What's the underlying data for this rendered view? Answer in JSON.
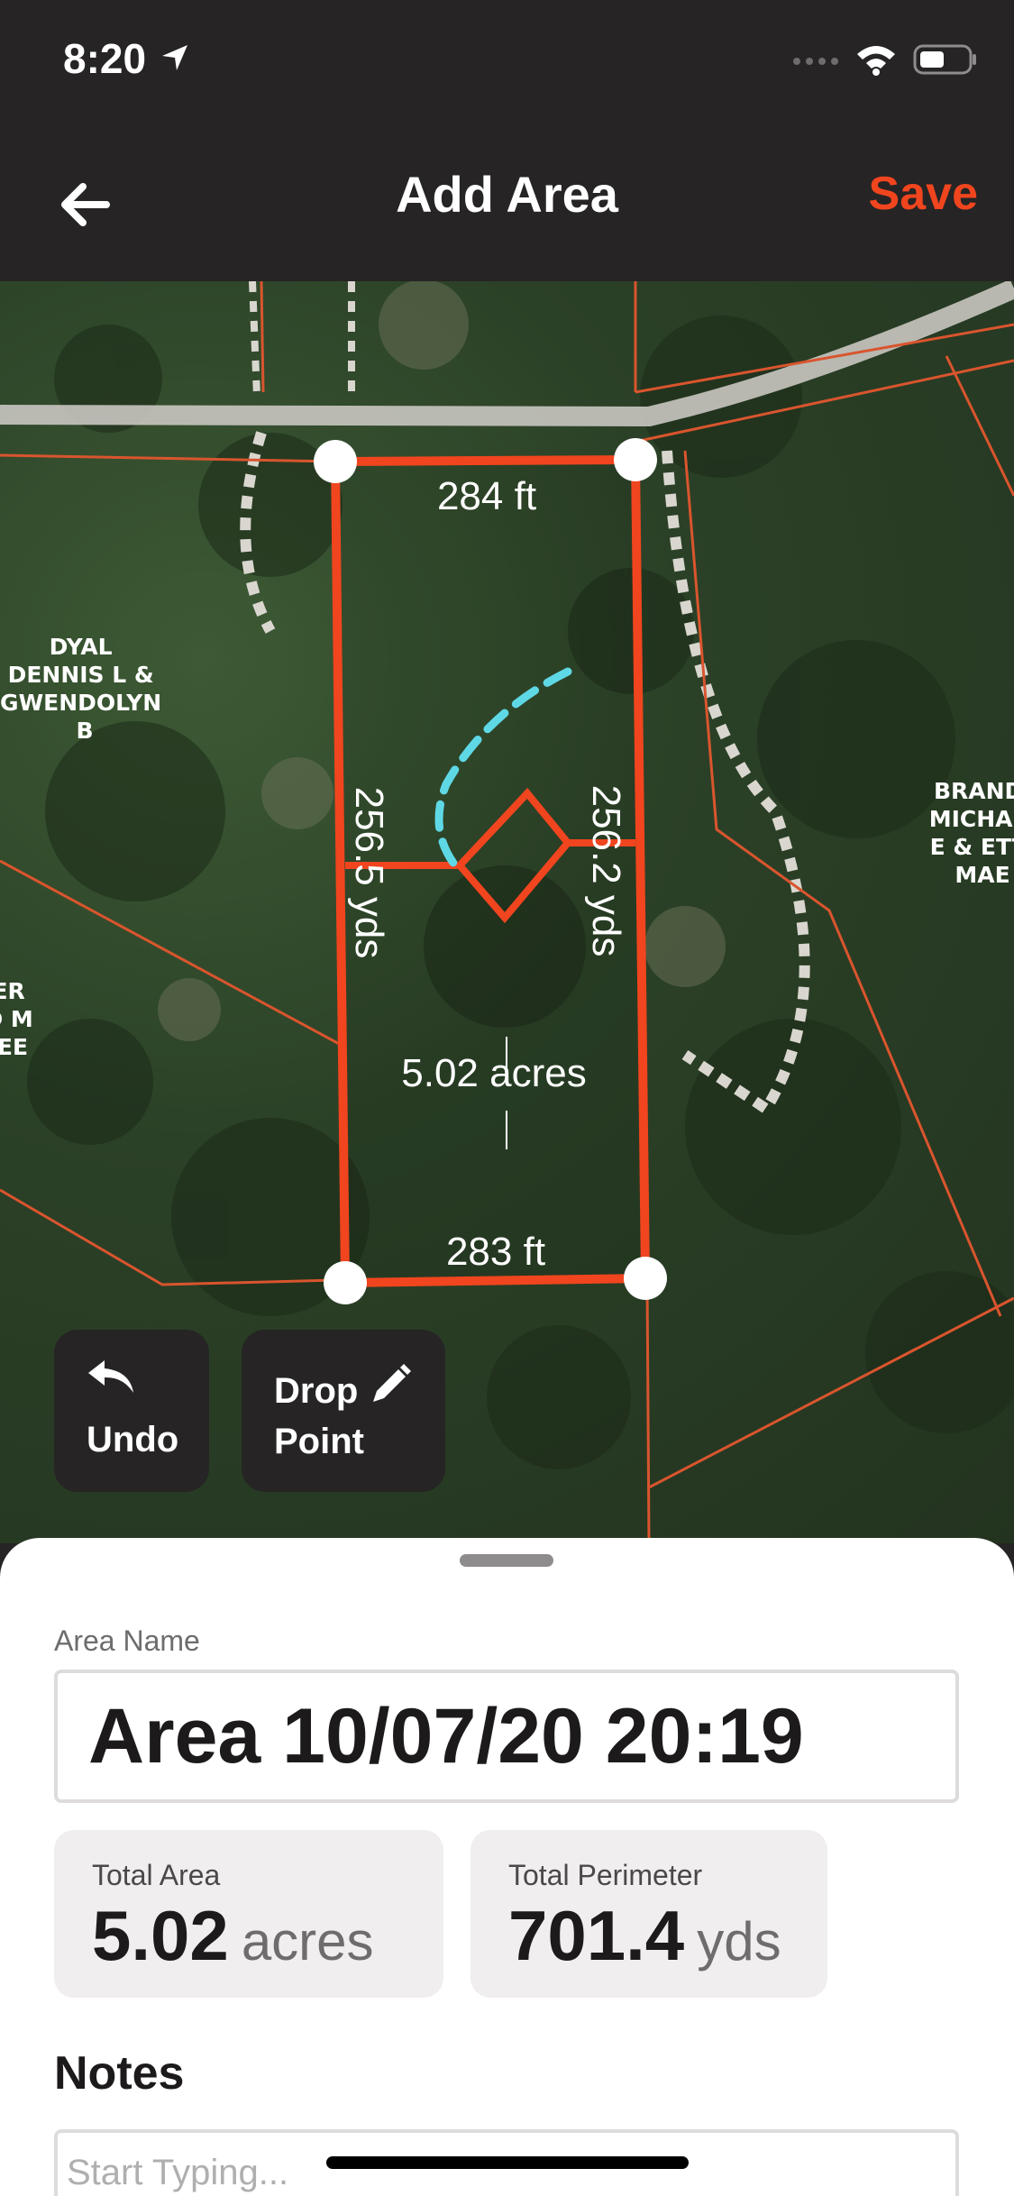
{
  "status_bar": {
    "time": "8:20"
  },
  "nav": {
    "title": "Add Area",
    "save_label": "Save"
  },
  "map": {
    "owner_labels": [
      {
        "text": "DYAL\nDENNIS L &\nGWENDOLYN\nB"
      },
      {
        "text": "BRAND\nMICHAE\nE & ETT\nMAE"
      },
      {
        "text": "ER\nD M\nEE"
      }
    ],
    "measurements": {
      "top": "284 ft",
      "bottom": "283 ft",
      "left": "256.5 yds",
      "right": "256.2 yds",
      "area": "5.02 acres"
    }
  },
  "controls": {
    "undo_label": "Undo",
    "drop_point_label": "Drop Point"
  },
  "sheet": {
    "area_name_label": "Area Name",
    "area_name_value": "Area 10/07/20 20:19",
    "total_area": {
      "label": "Total Area",
      "value": "5.02",
      "unit": "acres"
    },
    "total_perimeter": {
      "label": "Total Perimeter",
      "value": "701.4",
      "unit": "yds"
    },
    "notes_title": "Notes",
    "notes_placeholder": "Start Typing..."
  },
  "colors": {
    "accent": "#f0451e",
    "trail": "#5fd8e6"
  }
}
